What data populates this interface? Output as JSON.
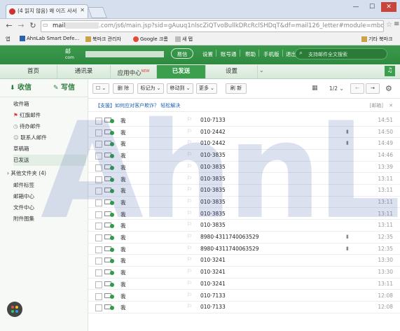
{
  "browser": {
    "tab_title": "(4 읽지 않음) 왜 이즈 사서",
    "url_start": "mail",
    "url_rest": ".com/js6/main.jsp?sid=gAuuq1nlscZiQTvoBullkDRcRclSHDqT&df=mail126_letter#module=mbo",
    "bookmarks": [
      "앱",
      "AhnLab Smart Defe...",
      "북마크 관리자",
      "Google 크롬",
      "새 탭"
    ],
    "other_bookmarks": "기타 북마크"
  },
  "mail_header": {
    "logo_text": "邮",
    "logo_domain": "com",
    "wechat_label": "易信",
    "links": [
      "设置",
      "账号通",
      "帮助",
      "手机版",
      "退出"
    ],
    "search_placeholder": "支持邮件全文搜索"
  },
  "nav_tabs": [
    "首页",
    "通讯录",
    "应用中心",
    "已发送",
    "设置"
  ],
  "app_badge": "NEW",
  "sidebar": {
    "receive": "收信",
    "write": "写信",
    "folders": [
      "收件箱",
      "红旗邮件",
      "待办邮件",
      "联系人邮件",
      "草稿箱",
      "已发送"
    ],
    "other_folders": "其他文件夹 (4)",
    "extras": [
      "邮件标签",
      "邮箱中心",
      "文件中心",
      "附件图集"
    ]
  },
  "toolbar": {
    "delete": "删 除",
    "mark_as": "标记为",
    "move_to": "移动到",
    "more": "更多",
    "refresh": "刷 新",
    "page": "1/2"
  },
  "notice": {
    "prefix": "【支援】如何应对客户欺诈？",
    "link": "轻松解决",
    "tag": "[邮箱]"
  },
  "rows": [
    {
      "sender": "我",
      "subject": "010·7133",
      "time": "14:51",
      "attach": false
    },
    {
      "sender": "我",
      "subject": "010·2442",
      "time": "14:50",
      "attach": true
    },
    {
      "sender": "我",
      "subject": "010·2442",
      "time": "14:49",
      "attach": true
    },
    {
      "sender": "我",
      "subject": "010·3835",
      "time": "14:46",
      "attach": false
    },
    {
      "sender": "我",
      "subject": "010·3835",
      "time": "13:39",
      "attach": false
    },
    {
      "sender": "我",
      "subject": "010·3835",
      "time": "13:11",
      "attach": false
    },
    {
      "sender": "我",
      "subject": "010·3835",
      "time": "13:11",
      "attach": false
    },
    {
      "sender": "我",
      "subject": "010·3835",
      "time": "13:11",
      "attach": false
    },
    {
      "sender": "我",
      "subject": "010·3835",
      "time": "13:11",
      "attach": false
    },
    {
      "sender": "我",
      "subject": "010·3835",
      "time": "13:11",
      "attach": false
    },
    {
      "sender": "我",
      "subject": "8980·4311740063529",
      "time": "12:35",
      "attach": true
    },
    {
      "sender": "我",
      "subject": "8980·4311740063529",
      "time": "12:35",
      "attach": true
    },
    {
      "sender": "我",
      "subject": "010·3241",
      "time": "13:30",
      "attach": false
    },
    {
      "sender": "我",
      "subject": "010·3241",
      "time": "13:30",
      "attach": false
    },
    {
      "sender": "我",
      "subject": "010·3241",
      "time": "13:11",
      "attach": false
    },
    {
      "sender": "我",
      "subject": "010·7133",
      "time": "12:08",
      "attach": false
    },
    {
      "sender": "我",
      "subject": "010·7133",
      "time": "12:08",
      "attach": false
    }
  ],
  "watermark": "AhnLab",
  "colors": {
    "brand_green": "#2f8a3f",
    "nav_active": "#3b9f4e",
    "watermark": "#3c5aaa"
  },
  "icons": [
    "back-icon",
    "forward-icon",
    "reload-icon",
    "star-icon",
    "menu-icon",
    "search-icon",
    "flag-icon",
    "paperclip-icon",
    "settings-icon",
    "calendar-icon"
  ]
}
